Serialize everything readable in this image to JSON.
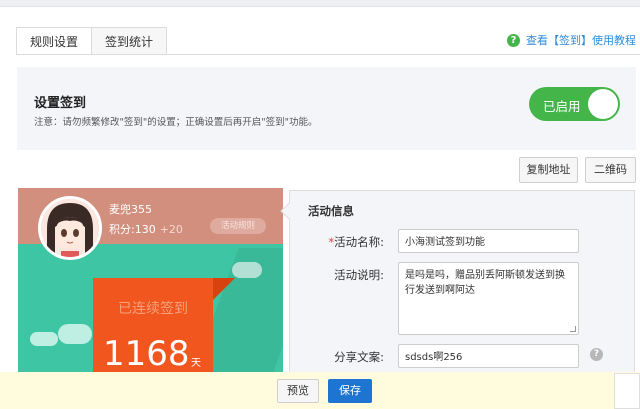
{
  "tabs": [
    {
      "label": "规则设置",
      "active": true
    },
    {
      "label": "签到统计",
      "active": false
    }
  ],
  "help_link": {
    "icon": "question-circle-icon",
    "text": "查看【签到】使用教程"
  },
  "setting": {
    "title": "设置签到",
    "note": "注意：请勿频繁修改\"签到\"的设置；正确设置后再开启\"签到\"功能。",
    "toggle_label": "已启用",
    "toggle_on": true
  },
  "buttons": {
    "copy_link": "复制地址",
    "qrcode": "二维码"
  },
  "preview": {
    "user_name": "麦兜355",
    "points": "积分:130",
    "points_plus": "+20",
    "rule_button": "活动规则",
    "streak_label": "已连续签到",
    "streak_days": "1168",
    "streak_unit": "天"
  },
  "form": {
    "title": "活动信息",
    "name_label": "活动名称:",
    "name_value": "小海测试签到功能",
    "desc_label": "活动说明:",
    "desc_value": "是吗是吗，赠品别丢阿斯顿发送到换行发送到啊阿达",
    "share_label": "分享文案:",
    "share_value": "sdsds啊256",
    "share_help_icon": "question-circle-icon"
  },
  "actions": {
    "preview": "预览",
    "save": "保存"
  },
  "colors": {
    "primary_green": "#44b549",
    "link_blue": "#2d8cdc",
    "save_blue": "#1d74d1",
    "preview_green": "#3ec5a3",
    "preview_orange": "#f1561f"
  }
}
